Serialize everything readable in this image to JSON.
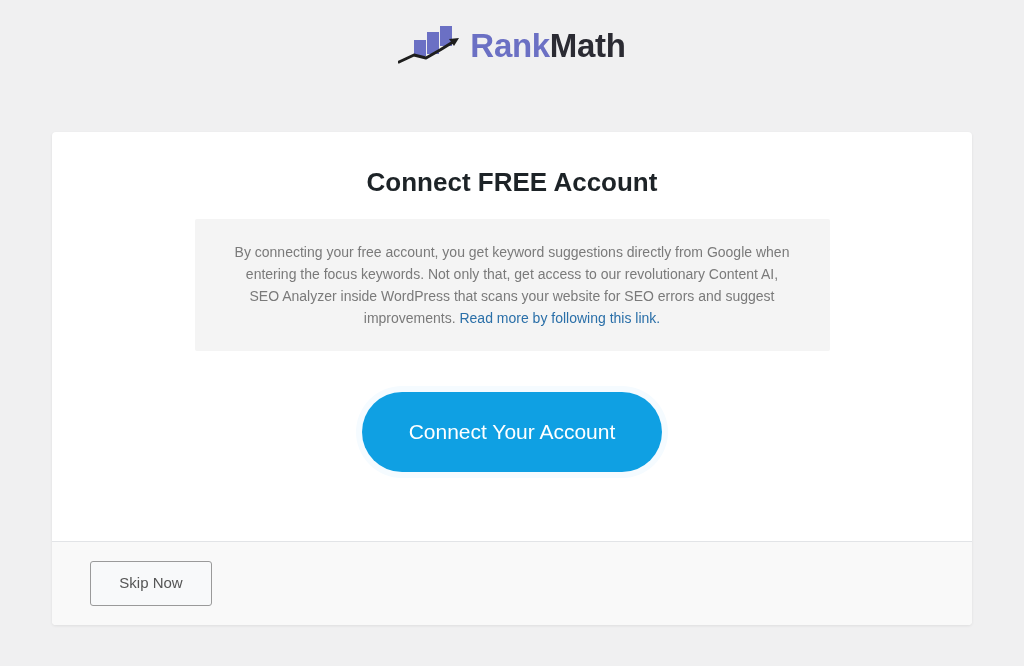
{
  "logo": {
    "words": [
      {
        "text": "Rank",
        "color": "#6b70c4"
      },
      {
        "text": "Math",
        "color": "#2b2b33"
      }
    ]
  },
  "card": {
    "title": "Connect FREE Account",
    "description": {
      "text": "By connecting your free account, you get keyword suggestions directly from Google when entering the focus keywords. Not only that, get access to our revolutionary Content AI, SEO Analyzer inside WordPress that scans your website for SEO errors and suggest improvements.",
      "link": "Read more by following this link."
    },
    "primary_button": "Connect Your Account",
    "footer": {
      "skip_button": "Skip Now"
    }
  }
}
